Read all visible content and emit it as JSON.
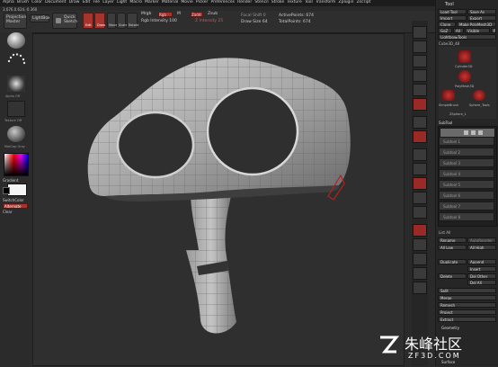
{
  "menu": [
    "Alpha",
    "Brush",
    "Color",
    "Document",
    "Draw",
    "Edit",
    "File",
    "Layer",
    "Light",
    "Macro",
    "Marker",
    "Material",
    "Movie",
    "Picker",
    "Preferences",
    "Render",
    "Stencil",
    "Stroke",
    "Texture",
    "Tool",
    "Transform",
    "Zplugin",
    "Zscript"
  ],
  "coords": "3.676,0.624,-0.360",
  "top": {
    "projection_master": "Projection Master",
    "lightbox": "LightBox",
    "quick_sketch": "Quick Sketch",
    "edit": "Edit",
    "draw": "Draw",
    "move": "Move",
    "scale": "Scale",
    "rotate": "Rotate",
    "mrgb": "Mrgb",
    "rgb": "Rgb",
    "m": "M",
    "rgb_intensity": "Rgb Intensity 100",
    "zadd": "Zadd",
    "zsub": "Zsub",
    "z_intensity": "Z Intensity 25",
    "focal_shift": "Focal Shift 0",
    "draw_size": "Draw Size 64",
    "active_points": "ActivePoints: 674",
    "total_points": "TotalPoints: 674"
  },
  "left": {
    "alpha_off": "Alpha Off",
    "texture_off": "Texture Off",
    "matcap": "MatCap Gray",
    "gradient": "Gradient",
    "switchcolor": "SwitchColor",
    "alternate": "Alternate",
    "clear": "Clear"
  },
  "tool": {
    "title": "Tool",
    "load_tool": "Load Tool",
    "save_as": "Save As",
    "import": "Import",
    "export": "Export",
    "clone": "Clone",
    "make_polymesh": "Make PolyMesh3D",
    "goz": "GoZ",
    "all": "All",
    "visible": "Visible",
    "r": "R",
    "lightbox_tools": "Lightbox▸Tools",
    "current_tool": "Cube3D_48",
    "thumbs": [
      "Cylinder3D",
      "PolyMesh3D",
      "SimpleBrush",
      "Sphere_Tools",
      "ZSphere_1"
    ],
    "subtool": "SubTool",
    "subtool_items": [
      "Subtool 1",
      "Subtool 2",
      "Subtool 3",
      "Subtool 4",
      "Subtool 5",
      "Subtool 6",
      "Subtool 7",
      "Subtool 8"
    ],
    "list_all": "List All",
    "rename": "Rename",
    "autoreorder": "AutoReorder",
    "all_low": "All Low",
    "all_high": "All High",
    "duplicate": "Duplicate",
    "append": "Append",
    "insert": "Insert",
    "delete": "Delete",
    "del_other": "Del Other",
    "del_all": "Del All",
    "split": "Split",
    "merge": "Merge",
    "remesh": "Remesh",
    "project": "Project",
    "extract": "Extract",
    "geometry": "Geometry",
    "surface": "Surface"
  },
  "watermark": {
    "brand": "朱峰社区",
    "domain": "ZF3D.COM"
  }
}
